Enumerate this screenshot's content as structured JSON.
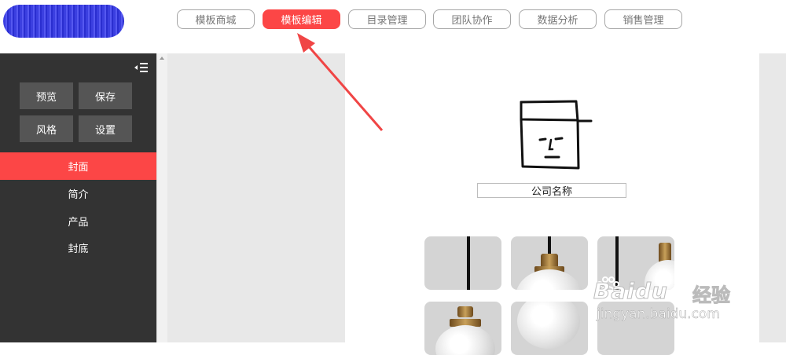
{
  "header": {
    "nav": [
      {
        "label": "模板商城",
        "active": false
      },
      {
        "label": "模板编辑",
        "active": true
      },
      {
        "label": "目录管理",
        "active": false
      },
      {
        "label": "团队协作",
        "active": false
      },
      {
        "label": "数据分析",
        "active": false
      },
      {
        "label": "销售管理",
        "active": false
      }
    ]
  },
  "sidebar": {
    "buttons": [
      {
        "label": "预览"
      },
      {
        "label": "保存"
      },
      {
        "label": "风格"
      },
      {
        "label": "设置"
      }
    ],
    "menu": [
      {
        "label": "封面",
        "active": true
      },
      {
        "label": "简介",
        "active": false
      },
      {
        "label": "产品",
        "active": false
      },
      {
        "label": "封底",
        "active": false
      }
    ]
  },
  "canvas": {
    "company_name": "公司名称"
  },
  "watermark": {
    "brand": "Baidu",
    "brand_cn": "经验",
    "url": "jingyan.baidu.com"
  },
  "colors": {
    "accent": "#fc4646",
    "sidebar": "#333333"
  }
}
